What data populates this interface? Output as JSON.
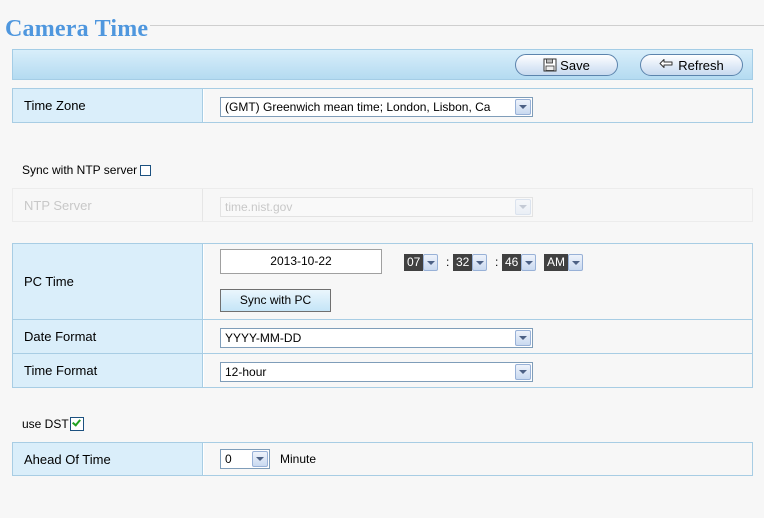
{
  "page": {
    "title": "Camera Time"
  },
  "toolbar": {
    "save_label": "Save",
    "refresh_label": "Refresh"
  },
  "time_zone": {
    "label": "Time Zone",
    "value": "(GMT) Greenwich mean time; London, Lisbon, Ca"
  },
  "ntp": {
    "sync_label": "Sync with NTP server",
    "sync_checked": false,
    "server_label": "NTP Server",
    "server_value": "time.nist.gov"
  },
  "pc_time": {
    "label": "PC Time",
    "date": "2013-10-22",
    "hour": "07",
    "minute": "32",
    "second": "46",
    "ampm": "AM",
    "sep": ":",
    "sync_button": "Sync with PC"
  },
  "date_format": {
    "label": "Date Format",
    "value": "YYYY-MM-DD"
  },
  "time_format": {
    "label": "Time Format",
    "value": "12-hour"
  },
  "dst": {
    "label": "use DST",
    "checked": true,
    "ahead_label": "Ahead Of Time",
    "ahead_value": "0",
    "unit": "Minute"
  },
  "colors": {
    "title": "#4f97de",
    "label_bg": "#daeefa",
    "border": "#a8cde4"
  }
}
